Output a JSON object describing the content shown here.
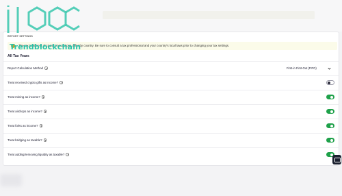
{
  "watermark": {
    "text": "Trendblockchain",
    "accent": "#2ac3a8"
  },
  "card": {
    "label": "REPORT SETTINGS",
    "notice": "The tax treatment of crypto transactions differ by country. Be sure to consult a tax professional and your country's local laws prior to changing your tax settings.",
    "section_title": "All Tax Years"
  },
  "method": {
    "label": "Report Calculation Method",
    "value": "First-in First-Out (FIFO)"
  },
  "settings": [
    {
      "label": "Treat received crypto gifts as income?",
      "enabled": false
    },
    {
      "label": "Treat mining as income?",
      "enabled": true
    },
    {
      "label": "Treat airdrops as income?",
      "enabled": true
    },
    {
      "label": "Treat forks as income?",
      "enabled": true
    },
    {
      "label": "Treat bridging as taxable?",
      "enabled": true
    },
    {
      "label": "Treat adding/removing liquidity as taxable?",
      "enabled": true
    }
  ],
  "colors": {
    "toggle_on": "#1fa14a",
    "toggle_off_knob": "#2b2b3a",
    "notice_bg": "#fbfbe9"
  },
  "icons": {
    "info": "info-circle-icon",
    "chevron": "chevron-down-icon",
    "chat": "chat-icon"
  }
}
